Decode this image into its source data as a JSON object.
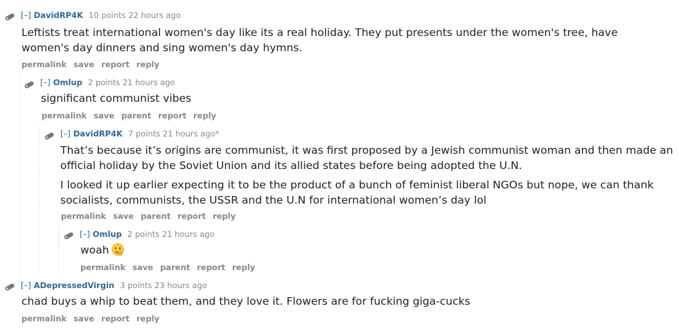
{
  "icon_name": "tag-icon",
  "comments": [
    {
      "collapse": "[–]",
      "author": "DavidRP4K",
      "score": "10 points",
      "time": "22 hours ago",
      "body": [
        "Leftists treat international women's day like its a real holiday. They put presents under the women's tree, have",
        "women's day dinners and sing women's day hymns."
      ],
      "actions": [
        "permalink",
        "save",
        "report",
        "reply"
      ]
    },
    {
      "collapse": "[–]",
      "author": "Omlup",
      "score": "2 points",
      "time": "21 hours ago",
      "body": [
        "significant communist vibes"
      ],
      "actions": [
        "permalink",
        "save",
        "parent",
        "report",
        "reply"
      ]
    },
    {
      "collapse": "[–]",
      "author": "DavidRP4K",
      "score": "7 points",
      "time": "21 hours ago*",
      "body": [
        "That’s because it’s origins are communist, it was first proposed by a Jewish communist woman and then made an",
        "official holiday by the Soviet Union and its allied states before being adopted the U.N.",
        "I looked it up earlier expecting it to be the product of a bunch of feminist liberal NGOs but nope, we can thank",
        "socialists, communists, the USSR and the U.N for international women’s day lol"
      ],
      "actions": [
        "permalink",
        "save",
        "parent",
        "report",
        "reply"
      ]
    },
    {
      "collapse": "[–]",
      "author": "Omlup",
      "score": "2 points",
      "time": "21 hours ago",
      "body": [
        "woah"
      ],
      "emoji": "thinking-face-emoji",
      "actions": [
        "permalink",
        "save",
        "parent",
        "report",
        "reply"
      ]
    },
    {
      "collapse": "[–]",
      "author": "ADepressedVirgin",
      "score": "3 points",
      "time": "23 hours ago",
      "body": [
        "chad buys a whip to beat them, and they love it. Flowers are for fucking giga-cucks"
      ],
      "actions": [
        "permalink",
        "save",
        "report",
        "reply"
      ]
    }
  ]
}
